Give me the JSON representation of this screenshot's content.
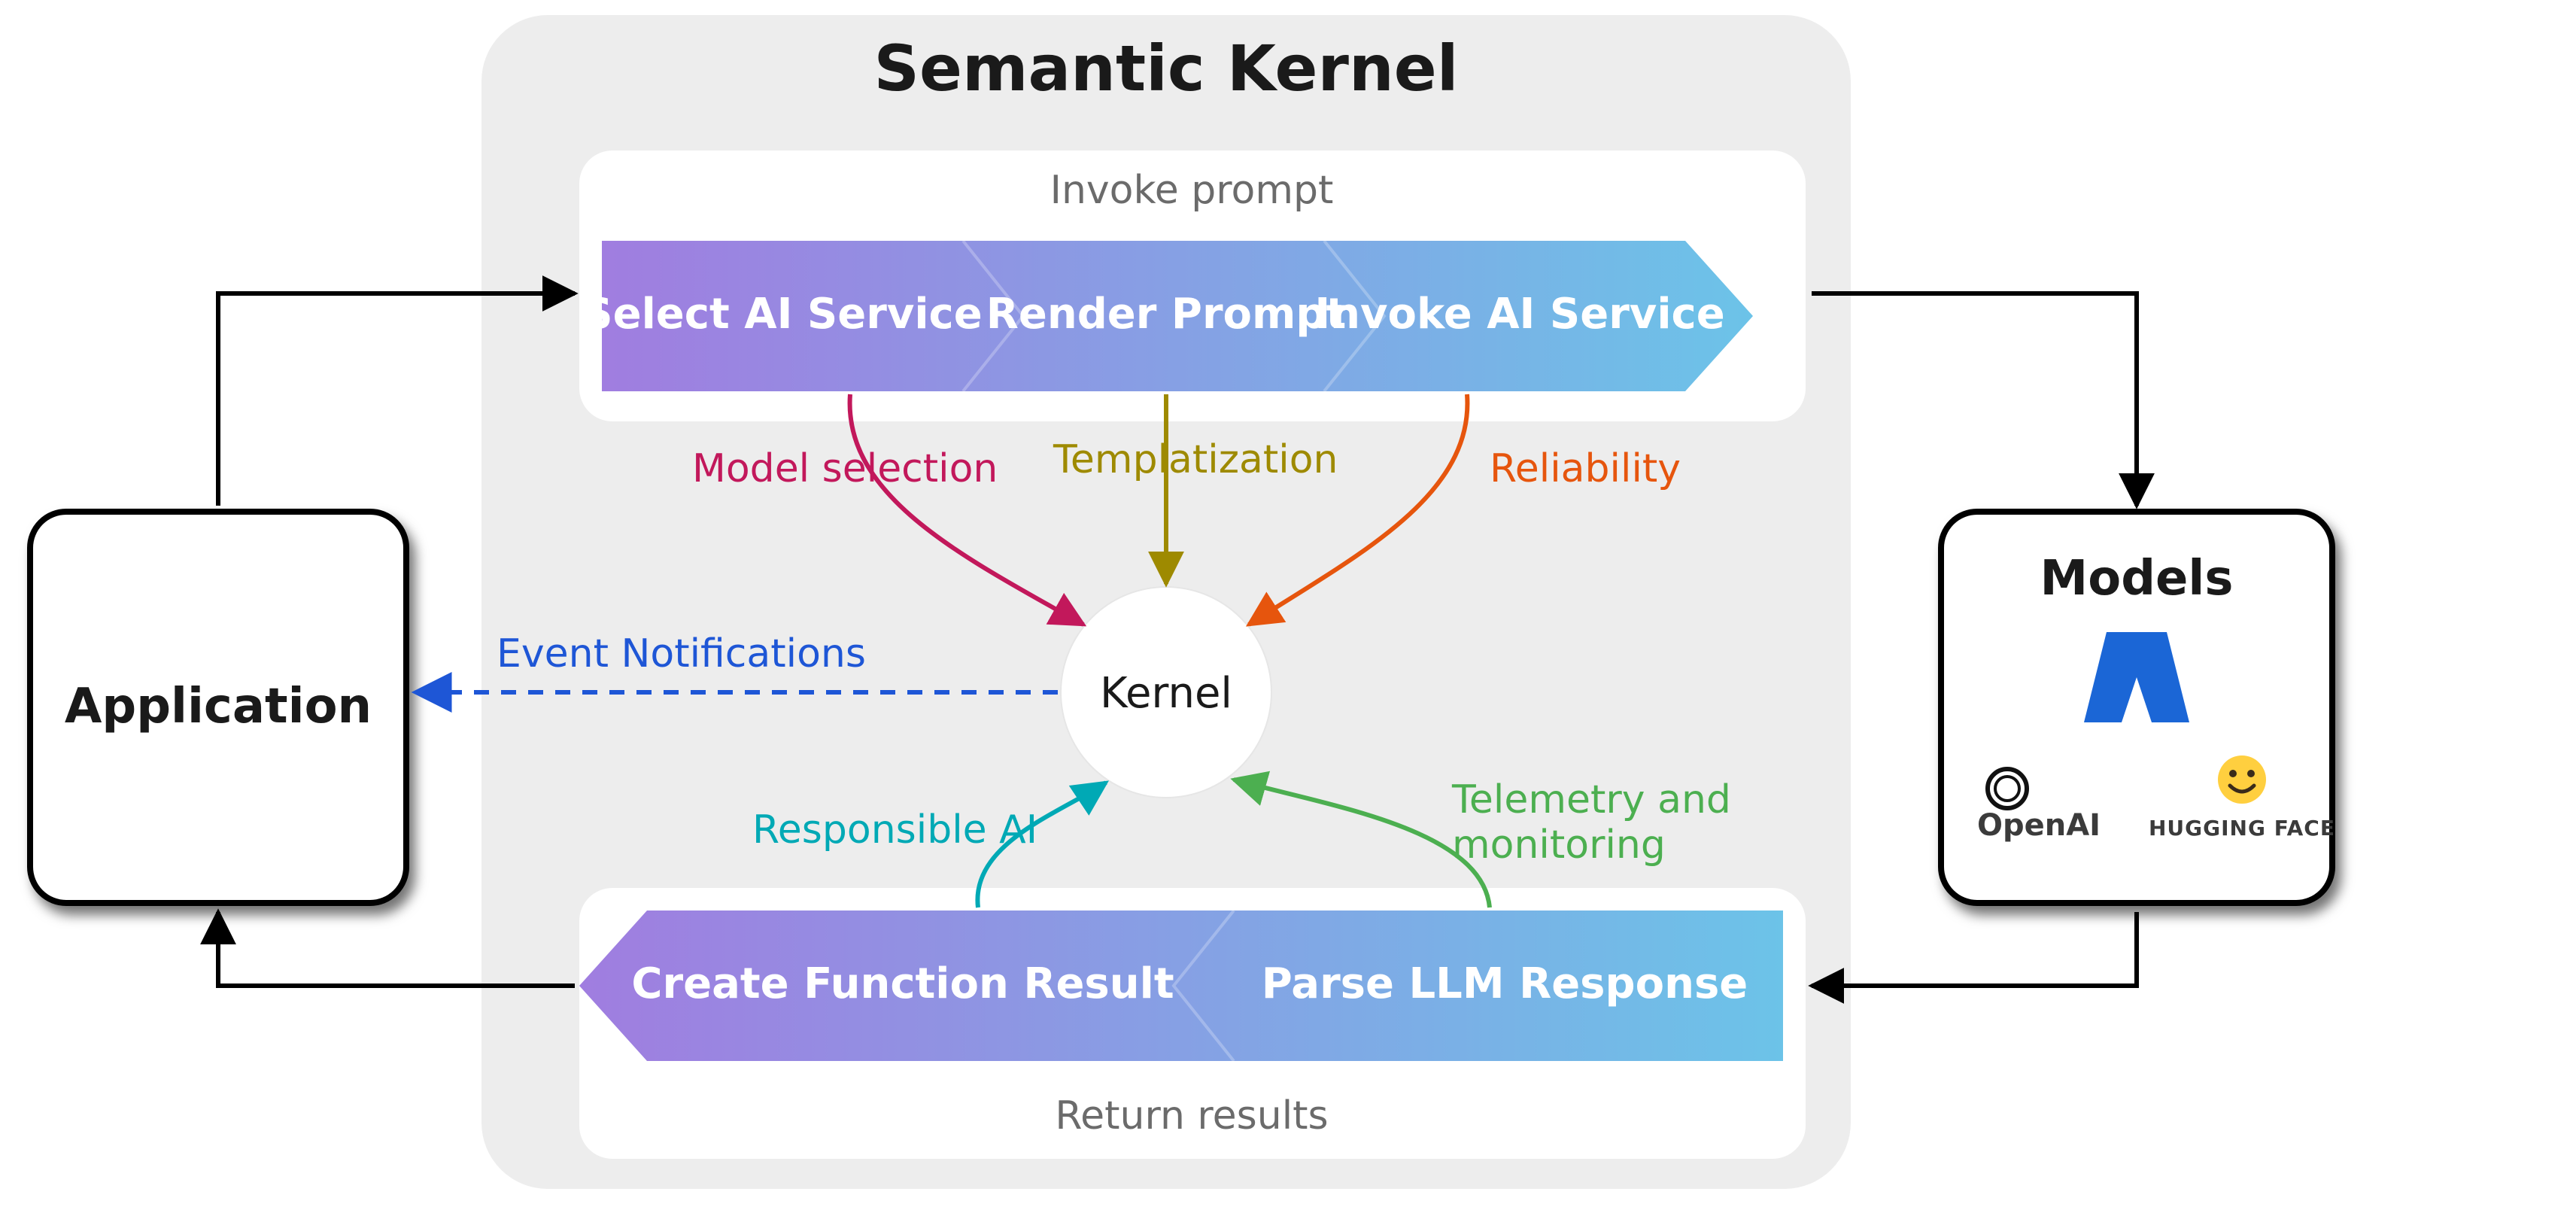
{
  "title": "Semantic Kernel",
  "left_node": {
    "label": "Application"
  },
  "right_node": {
    "title": "Models",
    "providers": [
      "OpenAI",
      "HUGGING FACE"
    ]
  },
  "center_node": {
    "label": "Kernel"
  },
  "invoke_section": {
    "caption": "Invoke prompt",
    "steps": [
      "Select AI Service",
      "Render Prompt",
      "Invoke AI Service"
    ]
  },
  "return_section": {
    "caption": "Return results",
    "steps": [
      "Create Function Result",
      "Parse LLM Response"
    ]
  },
  "curves": {
    "model_selection": {
      "label": "Model selection",
      "color": "#c2185b"
    },
    "templatization": {
      "label": "Templatization",
      "color": "#9e8a00"
    },
    "reliability": {
      "label": "Reliability",
      "color": "#e6550d"
    },
    "responsible_ai": {
      "label": "Responsible AI",
      "color": "#00a9b5"
    },
    "telemetry": {
      "label": "Telemetry and monitoring",
      "color": "#4caf50"
    }
  },
  "event_link": {
    "label": "Event Notifications",
    "color": "#1e56d6"
  },
  "colors": {
    "panel_bg": "#ededed",
    "card_bg": "#ffffff",
    "grad_start": "#a07de0",
    "grad_end": "#6cc3e8"
  }
}
